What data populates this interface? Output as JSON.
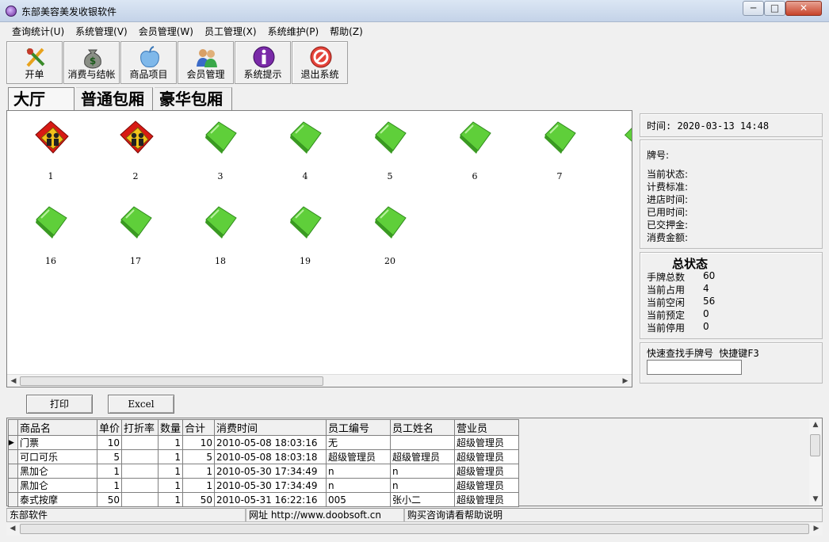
{
  "window": {
    "title": "东部美容美发收银软件"
  },
  "menu": [
    "查询统计(U)",
    "系统管理(V)",
    "会员管理(W)",
    "员工管理(X)",
    "系统维护(P)",
    "帮助(Z)"
  ],
  "toolbar": [
    {
      "label": "开单",
      "icon": "brush-pencil-icon"
    },
    {
      "label": "消费与结帐",
      "icon": "money-bag-icon"
    },
    {
      "label": "商品项目",
      "icon": "apple-icon"
    },
    {
      "label": "会员管理",
      "icon": "members-icon"
    },
    {
      "label": "系统提示",
      "icon": "info-icon"
    },
    {
      "label": "退出系统",
      "icon": "stop-icon"
    }
  ],
  "tabs": [
    "大厅",
    "普通包厢",
    "豪华包厢"
  ],
  "rooms": [
    {
      "num": "1",
      "status": "occupied"
    },
    {
      "num": "2",
      "status": "occupied"
    },
    {
      "num": "3",
      "status": "free"
    },
    {
      "num": "4",
      "status": "free"
    },
    {
      "num": "5",
      "status": "free"
    },
    {
      "num": "6",
      "status": "free"
    },
    {
      "num": "7",
      "status": "free"
    },
    {
      "num": "16",
      "status": "free"
    },
    {
      "num": "17",
      "status": "free"
    },
    {
      "num": "18",
      "status": "free"
    },
    {
      "num": "19",
      "status": "free"
    },
    {
      "num": "20",
      "status": "free"
    }
  ],
  "colors": {
    "occupied": "#d81a14",
    "free": "#5fcf3a",
    "occupied_figure": "#f2c21b"
  },
  "info": {
    "time": "时间: 2020-03-13 14:48",
    "plate": "牌号:",
    "fields": [
      "当前状态:",
      "计费标准:",
      "进店时间:",
      "已用时间:",
      "已交押金:",
      "消费金额:"
    ]
  },
  "summary": {
    "title": "总状态",
    "rows": [
      {
        "label": "手牌总数",
        "value": "60"
      },
      {
        "label": "当前占用",
        "value": "4"
      },
      {
        "label": "当前空闲",
        "value": "56"
      },
      {
        "label": "当前预定",
        "value": "0"
      },
      {
        "label": "当前停用",
        "value": "0"
      }
    ]
  },
  "quickfind": {
    "label": "快速查找手牌号  快捷键F3",
    "value": ""
  },
  "actions": {
    "print": "打印",
    "excel": "Excel"
  },
  "table": {
    "columns": [
      "商品名",
      "单价",
      "打折率",
      "数量",
      "合计",
      "消费时间",
      "员工编号",
      "员工姓名",
      "营业员"
    ],
    "rows": [
      [
        "门票",
        "10",
        "",
        "1",
        "10",
        "2010-05-08 18:03:16",
        "无",
        "",
        "超级管理员"
      ],
      [
        "可口可乐",
        "5",
        "",
        "1",
        "5",
        "2010-05-08 18:03:18",
        "超级管理员",
        "超级管理员",
        "超级管理员"
      ],
      [
        "黑加仑",
        "1",
        "",
        "1",
        "1",
        "2010-05-30 17:34:49",
        "n",
        "n",
        "超级管理员"
      ],
      [
        "黑加仑",
        "1",
        "",
        "1",
        "1",
        "2010-05-30 17:34:49",
        "n",
        "n",
        "超级管理员"
      ],
      [
        "泰式按摩",
        "50",
        "",
        "1",
        "50",
        "2010-05-31 16:22:16",
        "005",
        "张小二",
        "超级管理员"
      ]
    ]
  },
  "status": {
    "company": "东部软件",
    "url": "网址 http://www.doobsoft.cn",
    "help": "购买咨询请看帮助说明"
  }
}
